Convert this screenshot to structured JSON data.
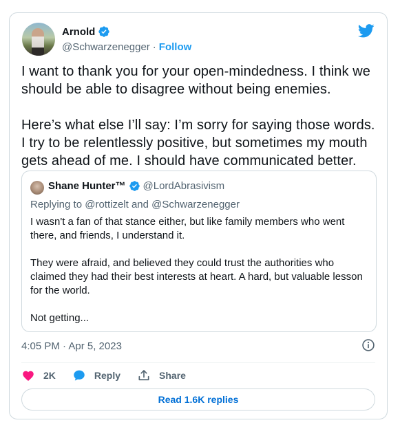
{
  "author": {
    "name": "Arnold",
    "handle": "@Schwarzenegger",
    "separator": "·",
    "follow_label": "Follow"
  },
  "tweet": {
    "text": "I want to thank you for your open-mindedness. I think we should be able to disagree without being enemies.\n\nHere’s what else I’ll say: I’m sorry for saying those words. I try to be relentlessly positive, but sometimes my mouth gets ahead of me. I should have communicated better.",
    "timestamp": "4:05 PM · Apr 5, 2023"
  },
  "quote": {
    "name": "Shane Hunter™",
    "handle": "@LordAbrasivism",
    "replying_prefix": "Replying to",
    "replying_to_1": "@rottizelt",
    "replying_and": "and",
    "replying_to_2": "@Schwarzenegger",
    "text": "I wasn't a fan of that stance either, but like family members who went there, and friends, I understand it.\n\nThey were afraid, and believed they could trust the authorities who claimed they had their best interests at heart. A hard, but valuable lesson for the world.\n\nNot getting..."
  },
  "actions": {
    "like_count": "2K",
    "reply_label": "Reply",
    "share_label": "Share"
  },
  "read_replies_label": "Read 1.6K replies",
  "icons": {
    "verified": "verified-badge-icon",
    "bird": "twitter-bird-icon",
    "info": "info-icon",
    "heart": "heart-icon",
    "reply": "reply-bubble-icon",
    "share": "share-icon"
  },
  "colors": {
    "brand_blue": "#1d9bf0",
    "like_pink": "#f91880",
    "text_primary": "#0f1419",
    "text_secondary": "#536471",
    "border": "#cfd9de",
    "link_blue": "#006fd6"
  }
}
